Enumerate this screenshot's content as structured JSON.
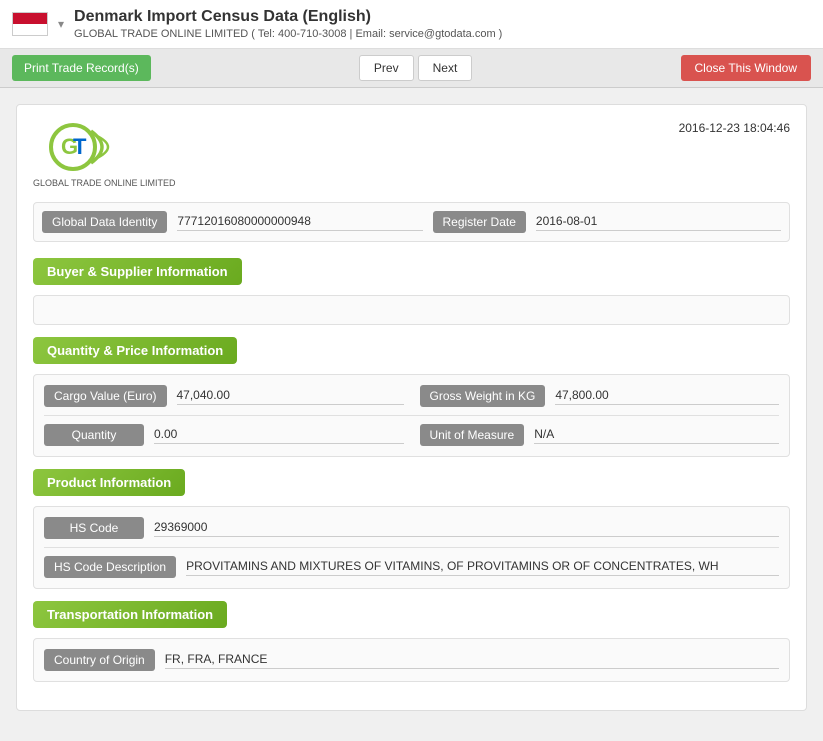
{
  "header": {
    "title": "Denmark Import Census Data (English)",
    "subtitle": "GLOBAL TRADE ONLINE LIMITED ( Tel: 400-710-3008 | Email: service@gtodata.com )",
    "dropdown_arrow": "▾"
  },
  "toolbar": {
    "print_label": "Print Trade Record(s)",
    "prev_label": "Prev",
    "next_label": "Next",
    "close_label": "Close This Window"
  },
  "logo": {
    "company_name": "GLOBAL TRADE ONLINE LIMITED",
    "timestamp": "2016-12-23 18:04:46"
  },
  "identity": {
    "global_data_label": "Global Data Identity",
    "global_data_value": "77712016080000000948",
    "register_date_label": "Register Date",
    "register_date_value": "2016-08-01"
  },
  "sections": {
    "buyer_supplier": {
      "title": "Buyer & Supplier Information"
    },
    "quantity_price": {
      "title": "Quantity & Price Information",
      "cargo_value_label": "Cargo Value (Euro)",
      "cargo_value": "47,040.00",
      "gross_weight_label": "Gross Weight in KG",
      "gross_weight": "47,800.00",
      "quantity_label": "Quantity",
      "quantity": "0.00",
      "unit_of_measure_label": "Unit of Measure",
      "unit_of_measure": "N/A"
    },
    "product": {
      "title": "Product Information",
      "hs_code_label": "HS Code",
      "hs_code": "29369000",
      "hs_desc_label": "HS Code Description",
      "hs_desc": "PROVITAMINS AND MIXTURES OF VITAMINS, OF PROVITAMINS OR OF CONCENTRATES, WH"
    },
    "transportation": {
      "title": "Transportation Information",
      "country_origin_label": "Country of Origin",
      "country_origin": "FR, FRA, FRANCE"
    }
  }
}
